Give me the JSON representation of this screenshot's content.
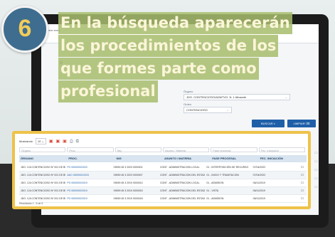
{
  "step": {
    "number": "6"
  },
  "caption": {
    "lines": [
      "En la búsqueda aparecerán",
      "los procedimientos de los",
      "que formes parte como",
      "profesional"
    ]
  },
  "background_screen": {
    "filters": [
      {
        "label": "Órgano",
        "value": "JDO. CONTENCIOSO/ADMTVO. N. 1 Albacete"
      },
      {
        "label": "Orden",
        "value": "CONTENCIOSO"
      }
    ],
    "buttons": {
      "search": "BUSCAR",
      "clear": "LIMPIAR"
    }
  },
  "results": {
    "records_label": "Mostrando",
    "records_per_page": "10",
    "filters": [
      "Órgano",
      "Proc.",
      "Nig",
      "Asunto / Materia",
      "Fase procesal",
      "Fec. iniciación"
    ],
    "columns": [
      "ÓRGANO",
      "PROC.",
      "NIG",
      "ASUNTO / MATERIA",
      "FASE PROCESAL",
      "FEC. INICIACIÓN"
    ],
    "rows": [
      [
        "JDO. C/A CONTENCIOSO Nº 001 DE BURGOS",
        "PO 0000000/2023",
        "09059 45 3 2023 0000001",
        "CONT - ADMINISTRACION LOCAL",
        "01 - INTERPOSICIÓN DE RECURSO",
        "07/04/2022"
      ],
      [
        "JDO. C/A CONTENCIOSO Nº 001 DE BURGOS",
        "AAC 0000000/2023",
        "09059 45 3 2023 0000007",
        "CONT - ADMINISTRACION DEL ESTADO",
        "01 - INICIO Y TRAMITACION",
        "07/04/2022"
      ],
      [
        "JDO. C/A CONTENCIOSO Nº 001 DE BURGOS",
        "PO 0000000/2019",
        "09059 45 3 2019 0000014",
        "CONT - ADMINISTRACION LOCAL",
        "01 - ADMISION",
        "06/11/2019"
      ],
      [
        "JDO. C/A CONTENCIOSO Nº 001 DE BURGOS",
        "PO 0000000/2019",
        "09059 45 3 2019 0000015",
        "CONT - ADMINISTRACION DEL ESTADO",
        "01 - VISTA",
        "06/11/2019"
      ],
      [
        "JDO. C/A CONTENCIOSO Nº 001 DE BURGOS",
        "PO 0000000/2019",
        "09059 45 3 2019 0000018",
        "CONT - ADMINISTRACION DEL ESTADO",
        "01 - ADMISION",
        "06/11/2019"
      ]
    ],
    "footer": "Resultados 1 - 5 de 5"
  },
  "colors": {
    "circle": "#3e6d8f",
    "step_number": "#f2cc5b",
    "caption_highlight": "#a8be6e",
    "panel_border": "#eec24a",
    "header_bg": "#d8e4ef",
    "button": "#1f5fa8"
  }
}
